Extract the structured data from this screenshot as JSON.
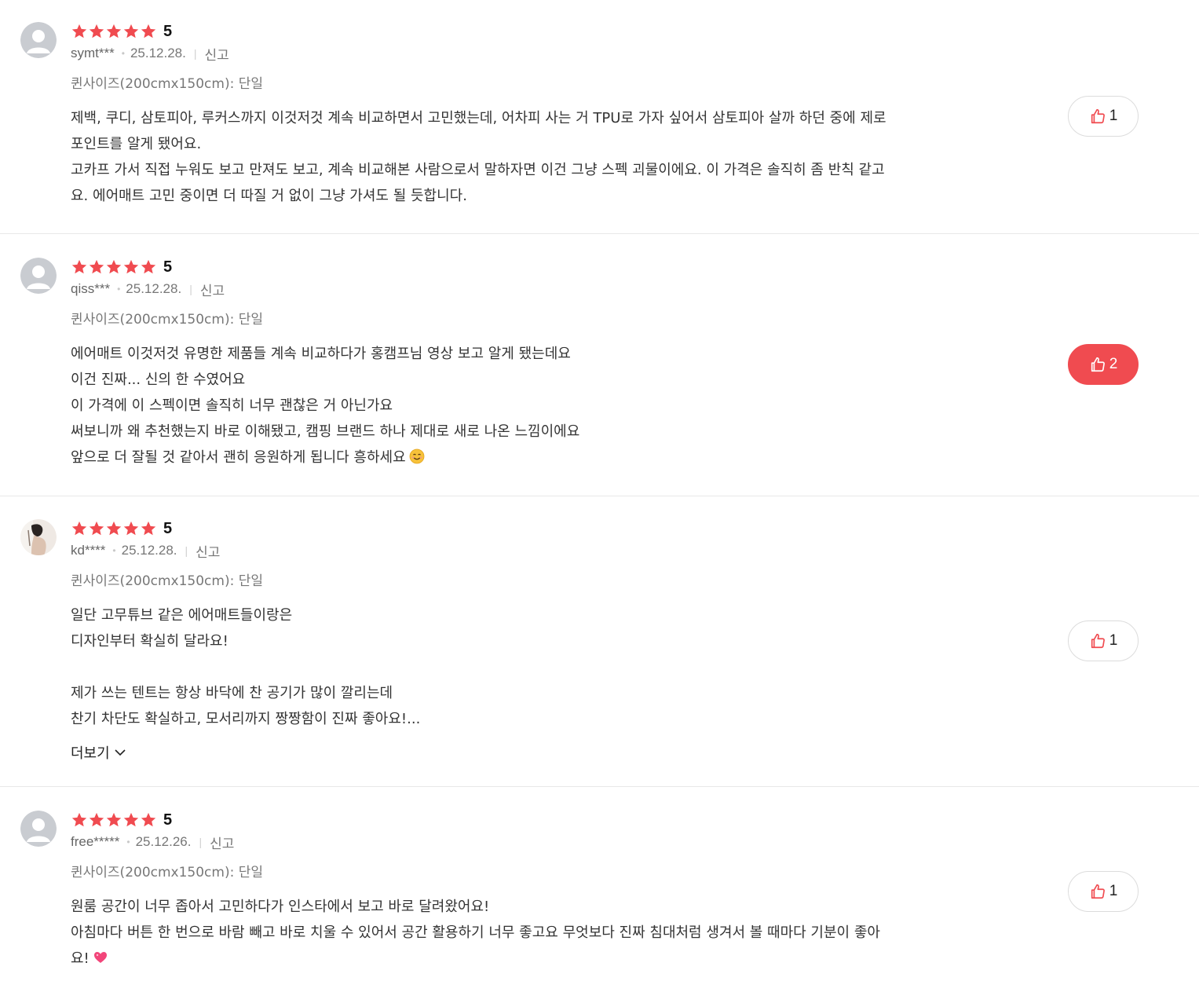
{
  "colors": {
    "star": "#f04b50",
    "like_active_bg": "#f04b50",
    "divider": "#e8e8e8"
  },
  "reviews": [
    {
      "rating": 5,
      "rating_label": "5",
      "user": "symt***",
      "date": "25.12.28.",
      "report_label": "신고",
      "option": "퀸사이즈(200cmx150cm): 단일",
      "lines": [
        "제백, 쿠디, 삼토피아, 루커스까지 이것저것 계속 비교하면서 고민했는데, 어차피 사는 거 TPU로 가자 싶어서 삼토피아 살까 하던 중에 제로",
        "포인트를 알게 됐어요.",
        "고카프 가서 직접 누워도 보고 만져도 보고, 계속 비교해본 사람으로서 말하자면 이건 그냥 스펙 괴물이에요. 이 가격은 솔직히 좀 반칙 같고",
        "요. 에어매트 고민 중이면 더 따질 거 없이 그냥 가셔도 될 듯합니다."
      ],
      "likes": "1",
      "liked": false,
      "avatar": "default-avatar-icon"
    },
    {
      "rating": 5,
      "rating_label": "5",
      "user": "qiss***",
      "date": "25.12.28.",
      "report_label": "신고",
      "option": "퀸사이즈(200cmx150cm): 단일",
      "lines": [
        "에어매트 이것저것 유명한 제품들 계속 비교하다가 홍캠프님 영상 보고 알게 됐는데요",
        "이건 진짜... 신의 한 수였어요",
        "이 가격에 이 스펙이면 솔직히 너무 괜찮은 거 아닌가요",
        "써보니까 왜 추천했는지 바로 이해됐고, 캠핑 브랜드 하나 제대로 새로 나온 느낌이에요",
        "앞으로 더 잘될 것 같아서 괜히 응원하게 됩니다 흥하세요"
      ],
      "emoji": "smiling-face-emoji",
      "likes": "2",
      "liked": true,
      "avatar": "default-avatar-icon"
    },
    {
      "rating": 5,
      "rating_label": "5",
      "user": "kd****",
      "date": "25.12.28.",
      "report_label": "신고",
      "option": "퀸사이즈(200cmx150cm): 단일",
      "lines": [
        "일단 고무튜브 같은 에어매트들이랑은",
        "디자인부터 확실히 달라요!",
        "",
        "제가 쓰는 텐트는 항상 바닥에 찬 공기가 많이 깔리는데",
        "찬기 차단도 확실하고, 모서리까지 짱짱함이 진짜 좋아요!..."
      ],
      "more_label": "더보기",
      "likes": "1",
      "liked": false,
      "avatar": "user-photo-avatar"
    },
    {
      "rating": 5,
      "rating_label": "5",
      "user": "free*****",
      "date": "25.12.26.",
      "report_label": "신고",
      "option": "퀸사이즈(200cmx150cm): 단일",
      "lines": [
        "원룸 공간이 너무 좁아서 고민하다가 인스타에서 보고 바로 달려왔어요!",
        "아침마다 버튼 한 번으로 바람 빼고 바로 치울 수 있어서 공간 활용하기 너무 좋고요 무엇보다 진짜 침대처럼 생겨서 볼 때마다 기분이 좋아",
        "요!"
      ],
      "emoji": "heart-emoji",
      "likes": "1",
      "liked": false,
      "avatar": "default-avatar-icon"
    }
  ]
}
